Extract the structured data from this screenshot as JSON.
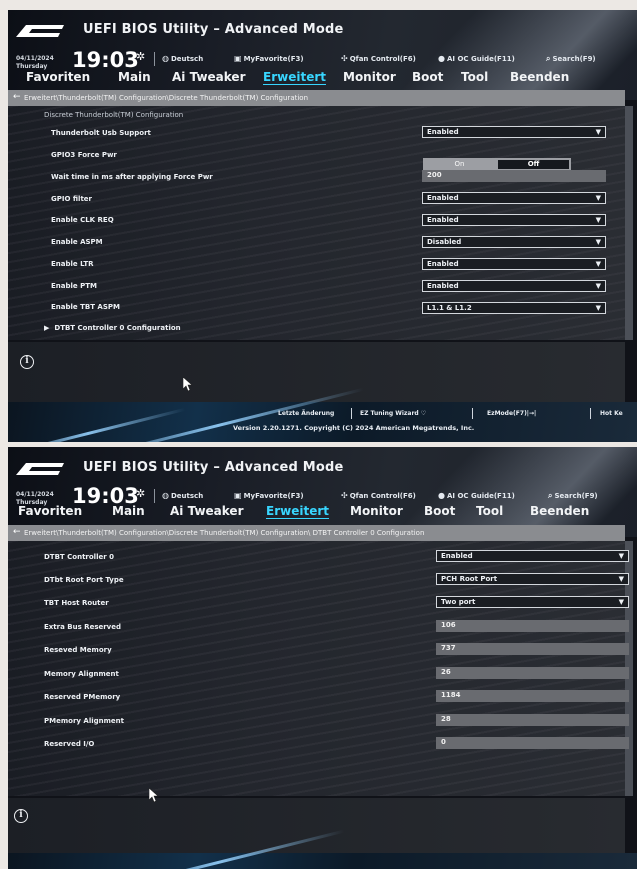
{
  "colors": {
    "accent": "#38d6ff",
    "header_bg": "#1a1e27",
    "crumb_bg": "#8a8c90",
    "field_bg": "#696b70"
  },
  "header": {
    "logo_text": "ASUS",
    "title": "UEFI BIOS Utility – Advanced Mode",
    "date": "04/11/2024",
    "day": "Thursday",
    "time": "19:03",
    "tools": {
      "language": "Deutsch",
      "favorites": "MyFavorite(F3)",
      "qfan": "Qfan Control(F6)",
      "aioc": "AI OC Guide(F11)",
      "search": "Search(F9)"
    }
  },
  "tabs": [
    "Favoriten",
    "Main",
    "Ai Tweaker",
    "Erweitert",
    "Monitor",
    "Boot",
    "Tool",
    "Beenden"
  ],
  "active_tab": "Erweitert",
  "screen1": {
    "breadcrumb": "Erweitert\\Thunderbolt(TM) Configuration\\Discrete Thunderbolt(TM) Configuration",
    "section_title": "Discrete Thunderbolt(TM) Configuration",
    "rows": [
      {
        "label": "Thunderbolt Usb Support",
        "value": "Enabled"
      },
      {
        "label": "GPIO3 Force Pwr",
        "on": "On",
        "off": "Off"
      },
      {
        "label": "Wait time in ms after applying Force Pwr",
        "value": "200"
      },
      {
        "label": "GPIO filter",
        "value": "Enabled"
      },
      {
        "label": "Enable CLK REQ",
        "value": "Enabled"
      },
      {
        "label": "Enable ASPM",
        "value": "Disabled"
      },
      {
        "label": "Enable LTR",
        "value": "Enabled"
      },
      {
        "label": "Enable PTM",
        "value": "Enabled"
      },
      {
        "label": "Enable TBT ASPM",
        "value": "L1.1 & L1.2"
      }
    ],
    "submenu": "DTBT Controller 0 Configuration"
  },
  "screen2": {
    "breadcrumb": "Erweitert\\Thunderbolt(TM) Configuration\\Discrete Thunderbolt(TM) Configuration\\ DTBT Controller 0 Configuration",
    "rows": [
      {
        "label": "DTBT Controller 0",
        "value": "Enabled"
      },
      {
        "label": "DTbt Root Port Type",
        "value": "PCH Root Port"
      },
      {
        "label": "TBT Host Router",
        "value": "Two port"
      },
      {
        "label": "Extra Bus Reserved",
        "value": "106"
      },
      {
        "label": "Reseved Memory",
        "value": "737"
      },
      {
        "label": "Memory Alignment",
        "value": "26"
      },
      {
        "label": "Reserved PMemory",
        "value": "1184"
      },
      {
        "label": "PMemory Alignment",
        "value": "28"
      },
      {
        "label": "Reserved I/O",
        "value": "0"
      }
    ]
  },
  "footer": {
    "last_change": "Letzte Änderung",
    "ez_tuning": "EZ Tuning Wizard",
    "ez_mode": "EzMode(F7)|→|",
    "hotkeys": "Hot Ke",
    "version": "Version 2.20.1271. Copyright (C) 2024 American Megatrends, Inc."
  }
}
